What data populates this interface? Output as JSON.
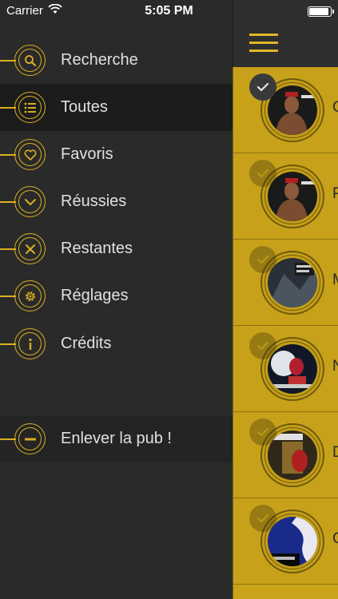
{
  "status": {
    "carrier": "Carrier",
    "time": "5:05 PM"
  },
  "menu": {
    "items": [
      {
        "label": "Recherche",
        "icon": "search-icon"
      },
      {
        "label": "Toutes",
        "icon": "list-icon"
      },
      {
        "label": "Favoris",
        "icon": "heart-icon"
      },
      {
        "label": "Réussies",
        "icon": "chevron-down-icon"
      },
      {
        "label": "Restantes",
        "icon": "close-icon"
      },
      {
        "label": "Réglages",
        "icon": "gear-icon"
      },
      {
        "label": "Crédits",
        "icon": "info-icon"
      }
    ],
    "remove_ads": {
      "label": "Enlever la pub !",
      "icon": "minus-icon"
    }
  },
  "list": {
    "rows": [
      {
        "letter": "C",
        "checked": true
      },
      {
        "letter": "P",
        "checked": false
      },
      {
        "letter": "M",
        "checked": false
      },
      {
        "letter": "N",
        "checked": false
      },
      {
        "letter": "D",
        "checked": false
      },
      {
        "letter": "C",
        "checked": false
      }
    ]
  },
  "colors": {
    "accent": "#d8b021",
    "list_bg": "#c9a319",
    "menu_bg": "#2a2a2a"
  }
}
